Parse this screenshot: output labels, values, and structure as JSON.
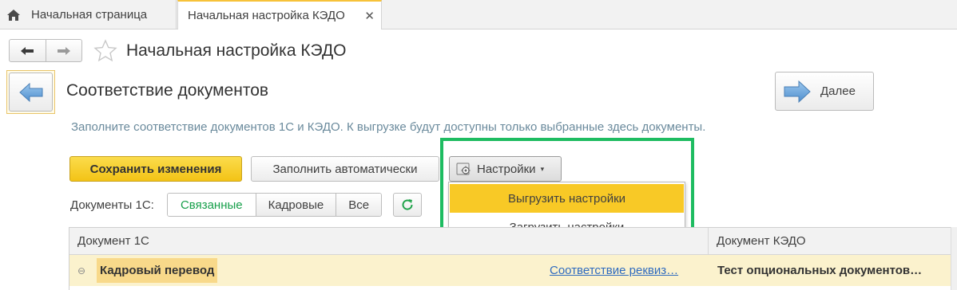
{
  "tabs": {
    "home_label": "Начальная страница",
    "active_label": "Начальная настройка КЭДО",
    "close_glyph": "✕"
  },
  "header": {
    "title": "Начальная настройка КЭДО"
  },
  "step": {
    "title": "Соответствие документов",
    "next_label": "Далее",
    "hint": "Заполните соответствие документов 1С и КЭДО. К выгрузке будут доступны только выбранные здесь документы."
  },
  "toolbar": {
    "save_label": "Сохранить изменения",
    "auto_fill_label": "Заполнить автоматически",
    "settings_label": "Настройки",
    "settings_caret": "▾"
  },
  "settings_menu": {
    "items": [
      "Выгрузить настройки",
      "Загрузить настройки"
    ],
    "selected_index": 0
  },
  "filters": {
    "label": "Документы 1С:",
    "options": [
      "Связанные",
      "Кадровые",
      "Все"
    ],
    "active_index": 0
  },
  "table": {
    "columns": [
      "Документ 1С",
      "Документ КЭДО"
    ],
    "rows": [
      {
        "collapse_glyph": "⊖",
        "name": "Кадровый перевод",
        "link": "Соответствие реквиз…",
        "kedo": "Тест опциональных документов…"
      }
    ]
  },
  "colors": {
    "accent_yellow": "#f8c926",
    "highlight_green": "#1ebc61",
    "active_filter": "#169f4a",
    "link": "#2f6bbf",
    "hint_text": "#6a8a9c"
  },
  "icons": [
    "home-icon",
    "back-arrow-icon",
    "forward-arrow-icon",
    "favorite-star-icon",
    "step-back-arrow-icon",
    "step-next-arrow-icon",
    "gear-icon",
    "refresh-icon",
    "collapse-icon"
  ]
}
